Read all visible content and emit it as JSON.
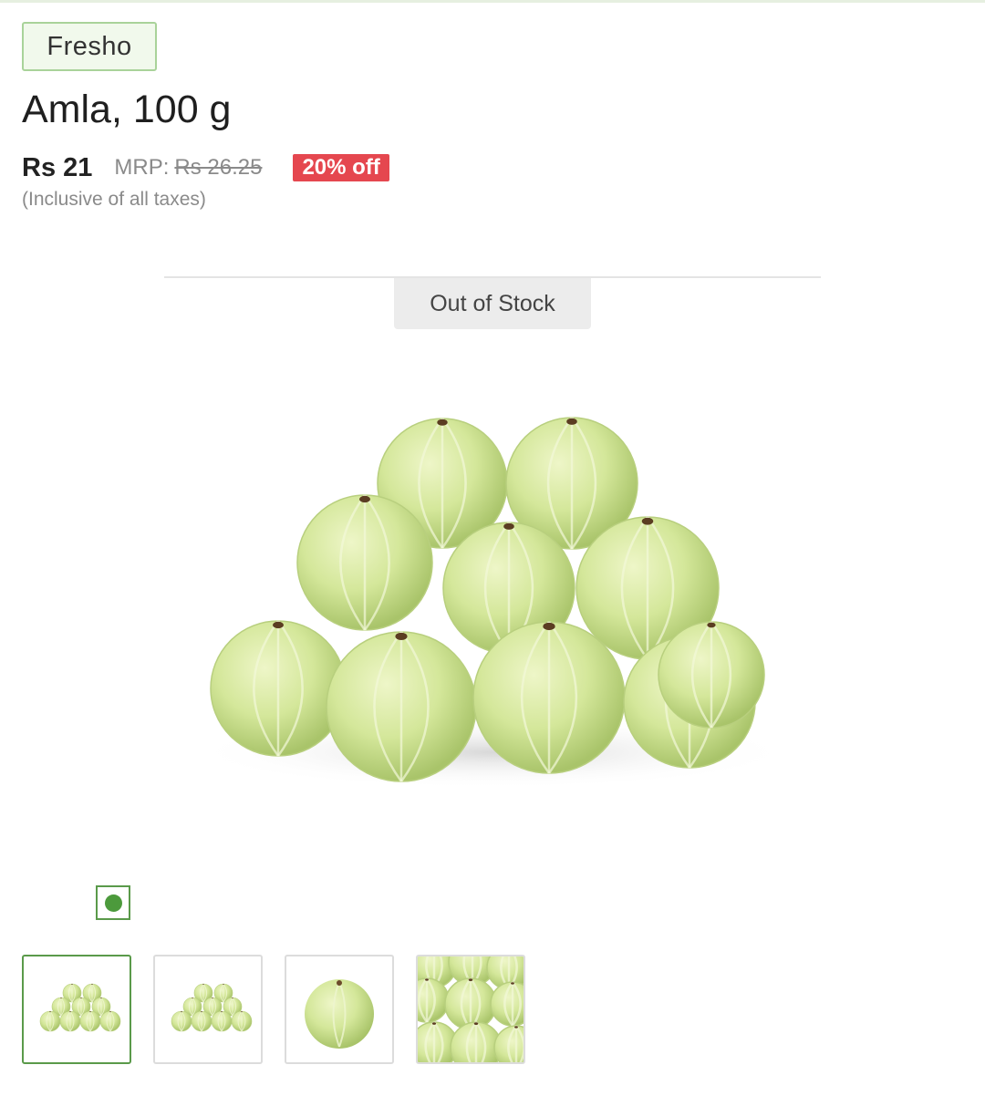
{
  "product": {
    "brand": "Fresho",
    "title": "Amla, 100 g",
    "price": "Rs 21",
    "mrp_label": "MRP:",
    "mrp_value": "Rs 26.25",
    "discount": "20% off",
    "tax_note": "(Inclusive of all taxes)",
    "stock_status": "Out of Stock"
  },
  "gallery": {
    "main_image": "amla-pile-image",
    "active_index": 0,
    "thumbnails": [
      {
        "name": "amla-pile-thumbnail"
      },
      {
        "name": "amla-pile-thumbnail"
      },
      {
        "name": "single-amla-thumbnail"
      },
      {
        "name": "amla-closeup-thumbnail"
      }
    ]
  },
  "colors": {
    "brand_border": "#a9d39a",
    "brand_bg": "#f1f9ec",
    "discount_bg": "#e5474f",
    "active_accent": "#5a9a4a",
    "fruit": "#d3e69a"
  }
}
